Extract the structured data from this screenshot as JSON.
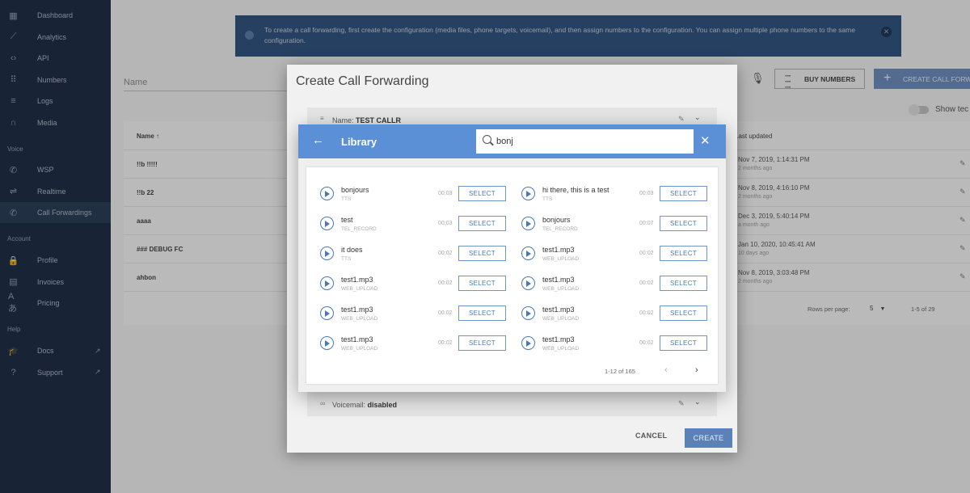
{
  "sidebar": {
    "items": [
      {
        "label": "Dashboard",
        "icon": "dashboard-icon",
        "glyph": "▦"
      },
      {
        "label": "Analytics",
        "icon": "trending-icon",
        "glyph": "⟋"
      },
      {
        "label": "API",
        "icon": "code-icon",
        "glyph": "‹›"
      },
      {
        "label": "Numbers",
        "icon": "dialpad-icon",
        "glyph": "⠿"
      },
      {
        "label": "Logs",
        "icon": "list-icon",
        "glyph": "≡"
      },
      {
        "label": "Media",
        "icon": "headphones-icon",
        "glyph": "∩"
      }
    ],
    "voice_section": "Voice",
    "voice_items": [
      {
        "label": "WSP",
        "icon": "phone-forward-icon",
        "glyph": "✆"
      },
      {
        "label": "Realtime",
        "icon": "call-split-icon",
        "glyph": "⇌"
      },
      {
        "label": "Call Forwardings",
        "icon": "phone-forwarded-icon",
        "glyph": "✆"
      }
    ],
    "account_section": "Account",
    "account_items": [
      {
        "label": "Profile",
        "icon": "lock-icon",
        "glyph": "🔒"
      },
      {
        "label": "Invoices",
        "icon": "receipt-icon",
        "glyph": "▤"
      },
      {
        "label": "Pricing",
        "icon": "translate-icon",
        "glyph": "Aあ"
      }
    ],
    "help_section": "Help",
    "help_items": [
      {
        "label": "Docs",
        "icon": "school-icon",
        "glyph": "🎓",
        "ext": "↗"
      },
      {
        "label": "Support",
        "icon": "help-icon",
        "glyph": "?",
        "ext": "↗"
      }
    ]
  },
  "banner": {
    "text": "To create a call forwarding, first create the configuration (media files, phone targets, voicemail), and then assign numbers to the configuration. You can assign multiple phone numbers to the same configuration."
  },
  "main": {
    "search_label": "Name",
    "buy_numbers": "BUY NUMBERS",
    "create_call_forwarding": "CREATE CALL FORWA",
    "show_technical": "Show tec",
    "table": {
      "col_name": "Name ↑",
      "col_last_updated": "Last updated",
      "rows": [
        {
          "name": "!!b !!!!!",
          "date": "Nov 7, 2019, 1:14:31 PM",
          "ago": "2 months ago"
        },
        {
          "name": "!!b 22",
          "date": "Nov 8, 2019, 4:16:10 PM",
          "ago": "2 months ago"
        },
        {
          "name": "aaaa",
          "date": "Dec 3, 2019, 5:40:14 PM",
          "ago": "a month ago"
        },
        {
          "name": "### DEBUG FC",
          "date": "Jan 10, 2020, 10:45:41 AM",
          "ago": "10 days ago"
        },
        {
          "name": "ahbon",
          "date": "Nov 8, 2019, 3:03:48 PM",
          "ago": "2 months ago"
        }
      ],
      "rows_per_page_label": "Rows per page:",
      "rows_per_page_value": "5",
      "range": "1-5 of 29"
    }
  },
  "create_dialog": {
    "title": "Create Call Forwarding",
    "name_label": "Name: ",
    "name_value": "TEST CALLR",
    "voicemail_label": "Voicemail: ",
    "voicemail_value": "disabled",
    "cancel": "CANCEL",
    "create": "CREATE"
  },
  "library": {
    "title": "Library",
    "search_value": "bonj",
    "select_label": "SELECT",
    "items": [
      {
        "name": "bonjours",
        "type": "TTS",
        "duration": "00:03"
      },
      {
        "name": "hi there, this is a test",
        "type": "TTS",
        "duration": "00:03"
      },
      {
        "name": "test",
        "type": "TEL_RECORD",
        "duration": "00:03"
      },
      {
        "name": "bonjours",
        "type": "TEL_RECORD",
        "duration": "00:07"
      },
      {
        "name": "it does",
        "type": "TTS",
        "duration": "00:02"
      },
      {
        "name": "test1.mp3",
        "type": "WEB_UPLOAD",
        "duration": "00:02"
      },
      {
        "name": "test1.mp3",
        "type": "WEB_UPLOAD",
        "duration": "00:02"
      },
      {
        "name": "test1.mp3",
        "type": "WEB_UPLOAD",
        "duration": "00:02"
      },
      {
        "name": "test1.mp3",
        "type": "WEB_UPLOAD",
        "duration": "00:02"
      },
      {
        "name": "test1.mp3",
        "type": "WEB_UPLOAD",
        "duration": "00:02"
      },
      {
        "name": "test1.mp3",
        "type": "WEB_UPLOAD",
        "duration": "00:02"
      },
      {
        "name": "test1.mp3",
        "type": "WEB_UPLOAD",
        "duration": "00:02"
      }
    ],
    "range": "1-12 of 165"
  }
}
